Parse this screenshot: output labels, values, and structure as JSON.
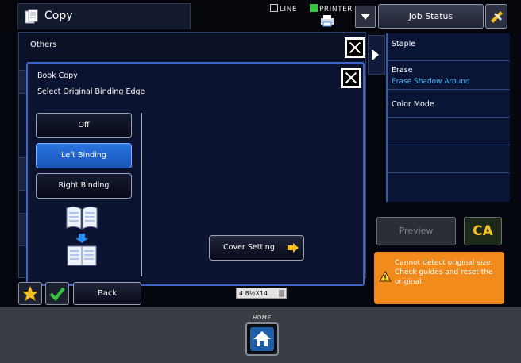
{
  "topbar": {
    "mode_title": "Copy",
    "line_indicator": "LINE",
    "printer_indicator": "PRINTER",
    "job_status_label": "Job Status"
  },
  "right_panel": {
    "items": [
      {
        "title": "Staple",
        "sub": ""
      },
      {
        "title": "Erase",
        "sub": "Erase Shadow Around"
      },
      {
        "title": "Color Mode",
        "sub": ""
      },
      {
        "title": "",
        "sub": ""
      },
      {
        "title": "",
        "sub": ""
      },
      {
        "title": "",
        "sub": ""
      }
    ],
    "preview_label": "Preview",
    "ca_label": "CA"
  },
  "warning": {
    "text": "Cannot detect original size. Check guides and reset the original."
  },
  "others_panel": {
    "title": "Others"
  },
  "dialog": {
    "title": "Book Copy",
    "subtitle": "Select Original Binding Edge",
    "options": [
      {
        "label": "Off",
        "selected": false
      },
      {
        "label": "Left Binding",
        "selected": true
      },
      {
        "label": "Right Binding",
        "selected": false
      }
    ],
    "cover_setting_label": "Cover Setting"
  },
  "bottom": {
    "back_label": "Back",
    "paper_size": "4 8½X14"
  },
  "bezel": {
    "home_label": "HOME"
  },
  "colors": {
    "accent_blue": "#2a74e0",
    "warning_orange": "#f28a1c",
    "ca_yellow": "#f0c020",
    "sub_text_cyan": "#44b8ff"
  }
}
